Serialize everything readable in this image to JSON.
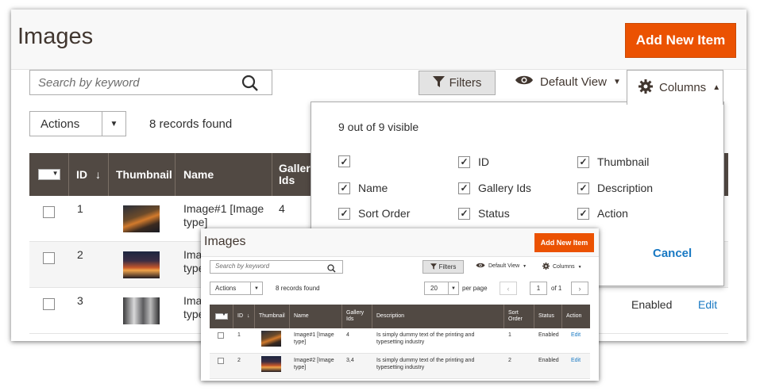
{
  "back": {
    "title": "Images",
    "add_new": "Add New Item",
    "search_placeholder": "Search by keyword",
    "filters": "Filters",
    "default_view": "Default View",
    "columns": "Columns",
    "actions": "Actions",
    "records_found": "8 records found",
    "headers": {
      "id": "ID",
      "thumbnail": "Thumbnail",
      "name": "Name",
      "gallery_ids": "Gallery Ids"
    },
    "rows": [
      {
        "id": "1",
        "name_line1": "Image#1 [Image",
        "name_line2": "type]",
        "gallery": "4"
      },
      {
        "id": "2",
        "name_line1": "Imag",
        "name_line2": "type",
        "gallery": ""
      },
      {
        "id": "3",
        "name_line1": "Imag",
        "name_line2": "type",
        "gallery": "",
        "status": "Enabled",
        "action": "Edit"
      }
    ]
  },
  "columns_panel": {
    "visible_text": "9 out of 9 visible",
    "options": [
      {
        "label": "",
        "checked": true
      },
      {
        "label": "ID",
        "checked": true
      },
      {
        "label": "Thumbnail",
        "checked": true
      },
      {
        "label": "Name",
        "checked": true
      },
      {
        "label": "Gallery Ids",
        "checked": true
      },
      {
        "label": "Description",
        "checked": true
      },
      {
        "label": "Sort Order",
        "checked": true
      },
      {
        "label": "Status",
        "checked": true
      },
      {
        "label": "Action",
        "checked": true
      }
    ],
    "cancel": "Cancel"
  },
  "front": {
    "title": "Images",
    "add_new": "Add New Item",
    "search_placeholder": "Search by keyword",
    "filters": "Filters",
    "default_view": "Default View",
    "columns": "Columns",
    "actions": "Actions",
    "records_found": "8 records found",
    "per_page_value": "20",
    "per_page_label": "per page",
    "page": "1",
    "of_pages": "of 1",
    "headers": {
      "id": "ID",
      "thumbnail": "Thumbnail",
      "name": "Name",
      "gallery_1": "Gallery",
      "gallery_2": "Ids",
      "description": "Description",
      "sort_1": "Sort",
      "sort_2": "Order",
      "status": "Status",
      "action": "Action"
    },
    "rows": [
      {
        "id": "1",
        "name_1": "Image#1 [Image",
        "name_2": "type]",
        "gallery": "4",
        "desc_1": "Is simply dummy text of the printing and",
        "desc_2": "typesetting industry",
        "sort": "1",
        "status": "Enabled",
        "action": "Edit"
      },
      {
        "id": "2",
        "name_1": "Image#2 [Image",
        "name_2": "type]",
        "gallery": "3,4",
        "desc_1": "Is simply dummy text of the printing and",
        "desc_2": "typesetting industry",
        "sort": "2",
        "status": "Enabled",
        "action": "Edit"
      }
    ]
  },
  "colors": {
    "accent": "#eb5202",
    "grid_header": "#514943",
    "link": "#1979c3"
  }
}
